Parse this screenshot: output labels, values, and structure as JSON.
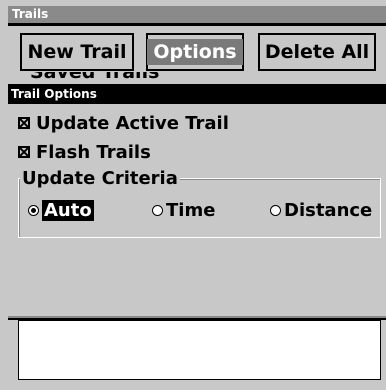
{
  "window": {
    "title": "Trails"
  },
  "toolbar": {
    "new_trail_label": "New Trail",
    "options_label": "Options",
    "delete_all_label": "Delete All"
  },
  "saved_trails_label": "Saved Trails",
  "dialog": {
    "title": "Trail Options",
    "update_active_trail": {
      "label": "Update Active Trail",
      "checked": true
    },
    "flash_trails": {
      "label": "Flash Trails",
      "checked": true
    },
    "update_criteria": {
      "label": "Update Criteria",
      "options": [
        {
          "label": "Auto",
          "selected": true
        },
        {
          "label": "Time",
          "selected": false
        },
        {
          "label": "Distance",
          "selected": false
        }
      ]
    }
  },
  "colors": {
    "background": "#c8c8c8",
    "title_bar": "#8a8a8a",
    "highlight": "#000000"
  }
}
